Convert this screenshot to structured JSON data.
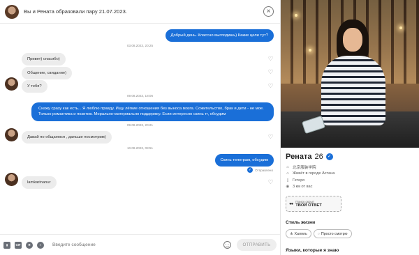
{
  "header": {
    "title": "Вы и Рената образовали пару 21.07.2023."
  },
  "messages": [
    {
      "text": "Добрый день. Классно выглядишь) Какие цели тут?"
    },
    {
      "text": "03.08.2023, 20:25"
    },
    {
      "text": "Привет) спасибо)"
    },
    {
      "text": "Общение, свидание)"
    },
    {
      "text": "У тебя?"
    },
    {
      "text": "09.08.2023, 18:06"
    },
    {
      "text": "Скажу сразу как есть... Я люблю правду. Ищу лёгкие отношения без выноса мозга. Сожительство, брак и дети - не мое. Только романтика и позитив. Морально-материально поддержку. Если интересно скинь тг, обсудим"
    },
    {
      "text": "09.08.2023, 20:21"
    },
    {
      "text": "Давай по общаемся , дальше посмотрим)"
    },
    {
      "text": "10.08.2023, 08:51"
    },
    {
      "text": "Скинь телеграм, обсудим"
    },
    {
      "text": "Отправлено"
    },
    {
      "text": "lamkarinanur"
    }
  ],
  "composer": {
    "placeholder": "Введите сообщение",
    "send_label": "ОТПРАВИТЬ",
    "gif_label": "GIF"
  },
  "profile": {
    "name": "Рената",
    "age": "26",
    "facts": [
      {
        "icon": "graduation-icon",
        "text": "北京服装学院"
      },
      {
        "icon": "home-icon",
        "text": "Живёт в городе Астана"
      },
      {
        "icon": "orientation-icon",
        "text": "Гетеро"
      },
      {
        "icon": "location-icon",
        "text": "3 км от вас"
      }
    ],
    "promo": {
      "small": "Поиск скрыт",
      "large": "ТВОЙ ОТВЕТ"
    },
    "lifestyle_title": "Стиль жизни",
    "lifestyle_tags": [
      "Халяль",
      "Просто смотрю"
    ],
    "languages_title": "Языки, которые я знаю"
  },
  "colors": {
    "accent": "#1a6fd8",
    "incoming_bubble": "#ececec"
  }
}
